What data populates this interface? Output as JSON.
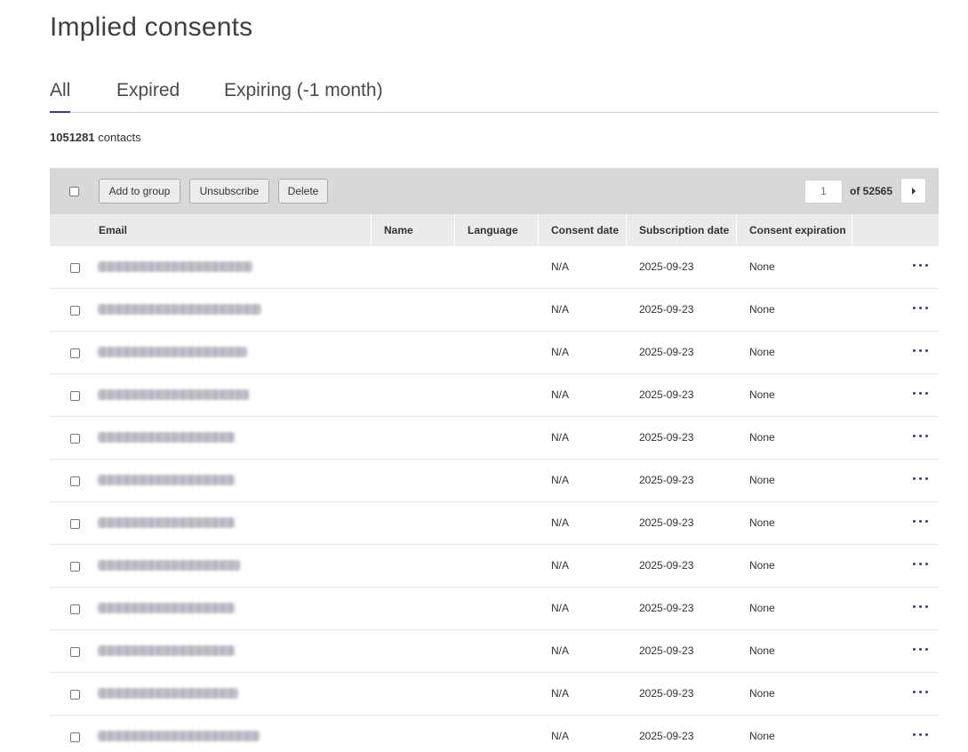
{
  "page": {
    "title": "Implied consents"
  },
  "tabs": [
    {
      "label": "All",
      "active": true
    },
    {
      "label": "Expired",
      "active": false
    },
    {
      "label": "Expiring (-1 month)",
      "active": false
    }
  ],
  "summary": {
    "count": "1051281",
    "count_label": "contacts"
  },
  "toolbar": {
    "add_to_group": "Add to group",
    "unsubscribe": "Unsubscribe",
    "delete": "Delete",
    "page_value": "1",
    "of_total": "of 52565"
  },
  "table": {
    "columns": [
      "Email",
      "Name",
      "Language",
      "Consent date",
      "Subscription date",
      "Consent expiration"
    ],
    "rows": [
      {
        "email": "[redacted]",
        "name": "",
        "language": "",
        "consent_date": "N/A",
        "subscription_date": "2025-09-23",
        "consent_expiration": "None"
      },
      {
        "email": "[redacted]",
        "name": "",
        "language": "",
        "consent_date": "N/A",
        "subscription_date": "2025-09-23",
        "consent_expiration": "None"
      },
      {
        "email": "[redacted]",
        "name": "",
        "language": "",
        "consent_date": "N/A",
        "subscription_date": "2025-09-23",
        "consent_expiration": "None"
      },
      {
        "email": "[redacted]",
        "name": "",
        "language": "",
        "consent_date": "N/A",
        "subscription_date": "2025-09-23",
        "consent_expiration": "None"
      },
      {
        "email": "[redacted]",
        "name": "",
        "language": "",
        "consent_date": "N/A",
        "subscription_date": "2025-09-23",
        "consent_expiration": "None"
      },
      {
        "email": "[redacted]",
        "name": "",
        "language": "",
        "consent_date": "N/A",
        "subscription_date": "2025-09-23",
        "consent_expiration": "None"
      },
      {
        "email": "[redacted]",
        "name": "",
        "language": "",
        "consent_date": "N/A",
        "subscription_date": "2025-09-23",
        "consent_expiration": "None"
      },
      {
        "email": "[redacted]",
        "name": "",
        "language": "",
        "consent_date": "N/A",
        "subscription_date": "2025-09-23",
        "consent_expiration": "None"
      },
      {
        "email": "[redacted]",
        "name": "",
        "language": "",
        "consent_date": "N/A",
        "subscription_date": "2025-09-23",
        "consent_expiration": "None"
      },
      {
        "email": "[redacted]",
        "name": "",
        "language": "",
        "consent_date": "N/A",
        "subscription_date": "2025-09-23",
        "consent_expiration": "None"
      },
      {
        "email": "[redacted]",
        "name": "",
        "language": "",
        "consent_date": "N/A",
        "subscription_date": "2025-09-23",
        "consent_expiration": "None"
      },
      {
        "email": "[redacted]",
        "name": "",
        "language": "",
        "consent_date": "N/A",
        "subscription_date": "2025-09-23",
        "consent_expiration": "None"
      }
    ]
  },
  "icons": {
    "row_menu": "more-horizontal-icon",
    "next_page": "caret-right-icon"
  },
  "colors": {
    "accent": "#3a35b8",
    "toolbar_bg": "#d8d8d8",
    "header_bg": "#ebebeb"
  }
}
